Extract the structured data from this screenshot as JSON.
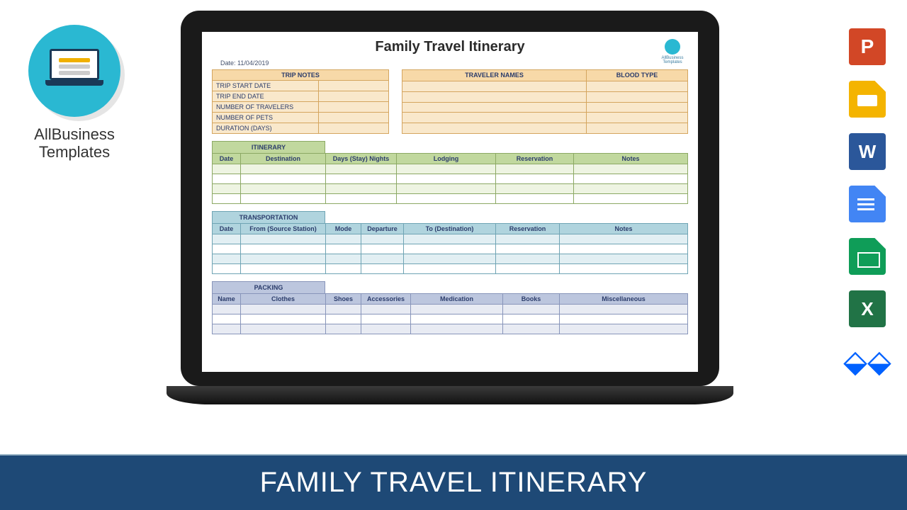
{
  "banner": {
    "title": "FAMILY TRAVEL ITINERARY"
  },
  "logo": {
    "line1": "AllBusiness",
    "line2": "Templates"
  },
  "fileIcons": {
    "ppt": "P",
    "word": "W",
    "excel": "X"
  },
  "doc": {
    "title": "Family Travel Itinerary",
    "smallLogoText": "AllBusiness\nTemplates",
    "dateLabel": "Date:",
    "dateValue": "11/04/2019",
    "tripNotes": {
      "header": "TRIP NOTES",
      "rows": [
        "TRIP START DATE",
        "TRIP END DATE",
        "NUMBER OF TRAVELERS",
        "NUMBER OF PETS",
        "DURATION (DAYS)"
      ]
    },
    "travelers": {
      "col1": "TRAVELER NAMES",
      "col2": "BLOOD TYPE"
    },
    "itinerary": {
      "title": "ITINERARY",
      "cols": [
        "Date",
        "Destination",
        "Days (Stay) Nights",
        "Lodging",
        "Reservation",
        "Notes"
      ]
    },
    "transport": {
      "title": "TRANSPORTATION",
      "cols": [
        "Date",
        "From (Source Station)",
        "Mode",
        "Departure",
        "To (Destination)",
        "Reservation",
        "Notes"
      ]
    },
    "packing": {
      "title": "PACKING",
      "cols": [
        "Name",
        "Clothes",
        "Shoes",
        "Accessories",
        "Medication",
        "Books",
        "Miscellaneous"
      ]
    }
  }
}
